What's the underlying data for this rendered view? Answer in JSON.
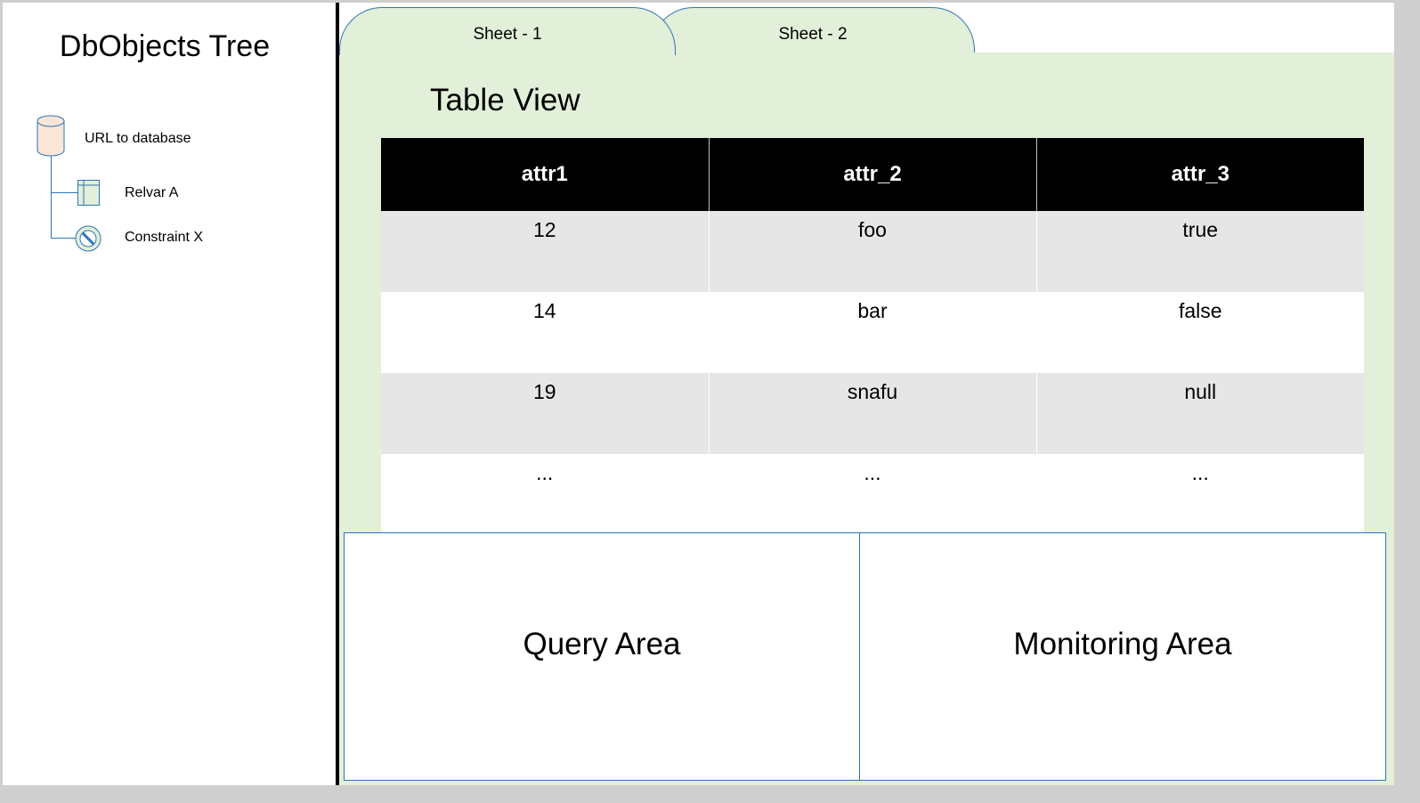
{
  "tree": {
    "title": "DbObjects Tree",
    "items": [
      {
        "label": "URL to database",
        "icon": "database-icon"
      },
      {
        "label": "Relvar A",
        "icon": "table-icon"
      },
      {
        "label": "Constraint X",
        "icon": "constraint-icon"
      }
    ]
  },
  "tabs": [
    {
      "label": "Sheet - 1"
    },
    {
      "label": "Sheet - 2"
    }
  ],
  "table_view": {
    "title": "Table View",
    "columns": [
      "attr1",
      "attr_2",
      "attr_3"
    ],
    "rows": [
      [
        "12",
        "foo",
        "true"
      ],
      [
        "14",
        "bar",
        "false"
      ],
      [
        "19",
        "snafu",
        "null"
      ],
      [
        "...",
        "...",
        "..."
      ]
    ]
  },
  "areas": {
    "query": "Query Area",
    "monitoring": "Monitoring Area"
  },
  "colors": {
    "sheet_bg": "#e2efd9",
    "outline_blue": "#2e75b6",
    "db_fill": "#fbe5d6",
    "header_bg": "#000000",
    "row_alt": "#e6e6e6"
  }
}
